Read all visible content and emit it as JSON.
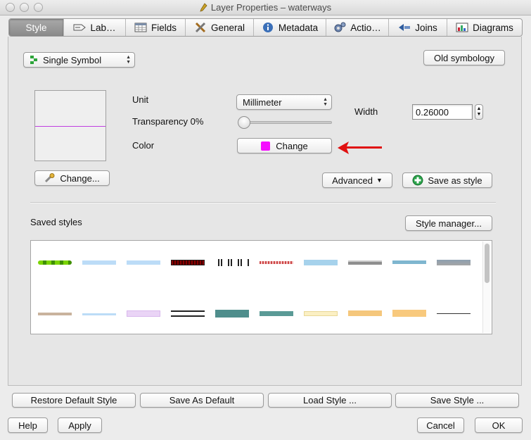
{
  "window": {
    "title": "Layer Properties – waterways"
  },
  "tabs": [
    {
      "label": "Style",
      "icon": "style-icon",
      "active": true
    },
    {
      "label": "Lab…",
      "icon": "labels-icon",
      "active": false
    },
    {
      "label": "Fields",
      "icon": "table-icon",
      "active": false
    },
    {
      "label": "General",
      "icon": "tools-icon",
      "active": false
    },
    {
      "label": "Metadata",
      "icon": "info-icon",
      "active": false
    },
    {
      "label": "Actio…",
      "icon": "gears-icon",
      "active": false
    },
    {
      "label": "Joins",
      "icon": "joins-icon",
      "active": false
    },
    {
      "label": "Diagrams",
      "icon": "diagram-icon",
      "active": false
    }
  ],
  "style": {
    "renderer_select": "Single Symbol",
    "old_symbology_label": "Old symbology",
    "unit_label": "Unit",
    "unit_select": "Millimeter",
    "width_label": "Width",
    "width_value": "0.26000",
    "transparency_label": "Transparency 0%",
    "transparency_value": 0,
    "color_label": "Color",
    "color_change_label": "Change",
    "color_value": "#f50cff",
    "symbol_change_label": "Change...",
    "advanced_label": "Advanced",
    "save_as_style_label": "Save as style",
    "saved_styles_label": "Saved styles",
    "style_manager_label": "Style manager..."
  },
  "footer": {
    "restore_default": "Restore Default Style",
    "save_as_default": "Save As Default",
    "load_style": "Load Style ...",
    "save_style": "Save Style ...",
    "help": "Help",
    "apply": "Apply",
    "cancel": "Cancel",
    "ok": "OK"
  },
  "colors": {
    "accent_arrow": "#e01010",
    "preview_line": "#c03fe0",
    "active_tab": "#9a9a9a"
  }
}
